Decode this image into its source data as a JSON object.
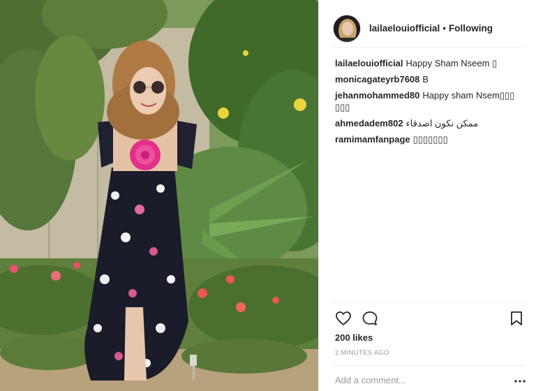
{
  "post": {
    "username": "lailaelouiofficial",
    "separator": "•",
    "follow_state": "Following"
  },
  "comments": [
    {
      "user": "lailaelouiofficial",
      "text": "Happy Sham Nseem ▯"
    },
    {
      "user": "monicagateyrb7608",
      "text": "B"
    },
    {
      "user": "jehanmohammed80",
      "text": "Happy sham Nsem▯▯▯ ▯▯▯"
    },
    {
      "user": "ahmedadem802",
      "text": "ممكن نكون اصدقاء"
    },
    {
      "user": "ramimamfanpage",
      "text": "▯▯▯▯▯▯▯"
    }
  ],
  "likes": "200 likes",
  "timestamp": "2 MINUTES AGO",
  "add_comment": {
    "placeholder": "Add a comment..."
  },
  "icons": {
    "like": "heart-icon",
    "comment": "speech-bubble-icon",
    "save": "bookmark-icon",
    "more": "more-dots-icon"
  },
  "colors": {
    "accent_text": "#262626",
    "muted": "#999999",
    "divider": "#efefef"
  }
}
